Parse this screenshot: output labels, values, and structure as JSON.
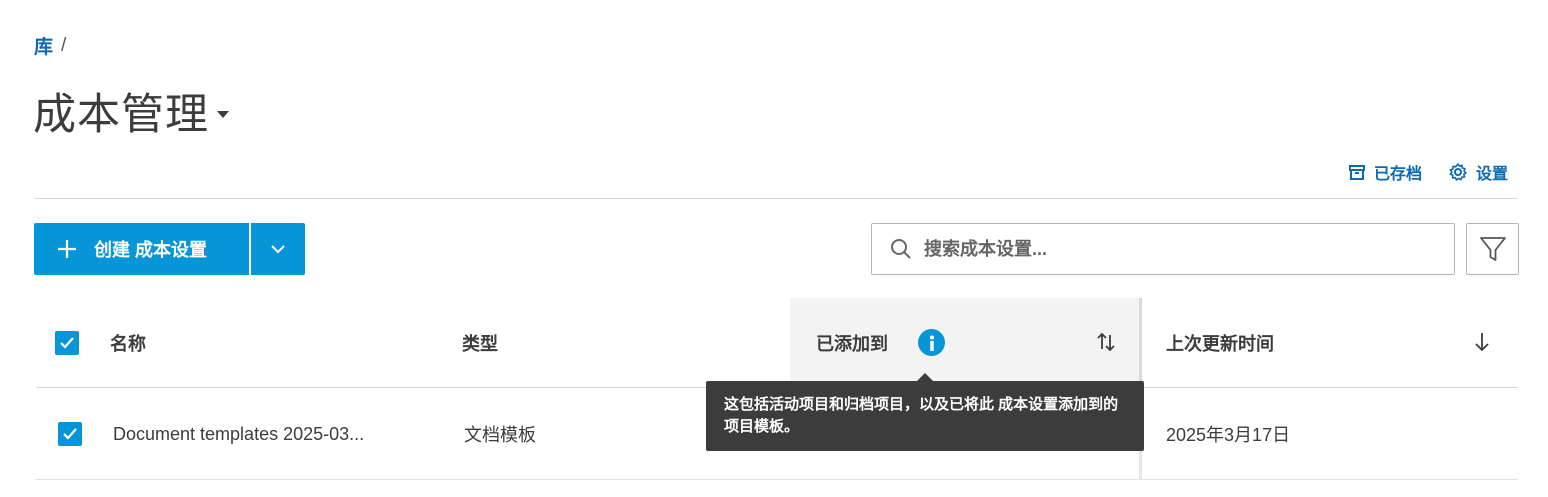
{
  "breadcrumb": {
    "link": "库",
    "separator": "/"
  },
  "page": {
    "title": "成本管理"
  },
  "top_actions": {
    "archived_label": "已存档",
    "settings_label": "设置"
  },
  "toolbar": {
    "create_label": "创建 成本设置",
    "search_placeholder": "搜索成本设置..."
  },
  "table": {
    "columns": {
      "name": "名称",
      "type": "类型",
      "added_to": "已添加到",
      "last_updated": "上次更新时间"
    },
    "rows": [
      {
        "name": "Document templates 2025-03...",
        "type": "文档模板",
        "added_to": "",
        "last_updated": "2025年3月17日",
        "checked": true
      }
    ],
    "header_checked": true
  },
  "tooltip": {
    "text": "这包括活动项目和归档项目，以及已将此 成本设置添加到的项目模板。"
  },
  "colors": {
    "accent": "#0696d7",
    "link": "#0a6ab2",
    "tooltip_bg": "#3c3c3c"
  }
}
